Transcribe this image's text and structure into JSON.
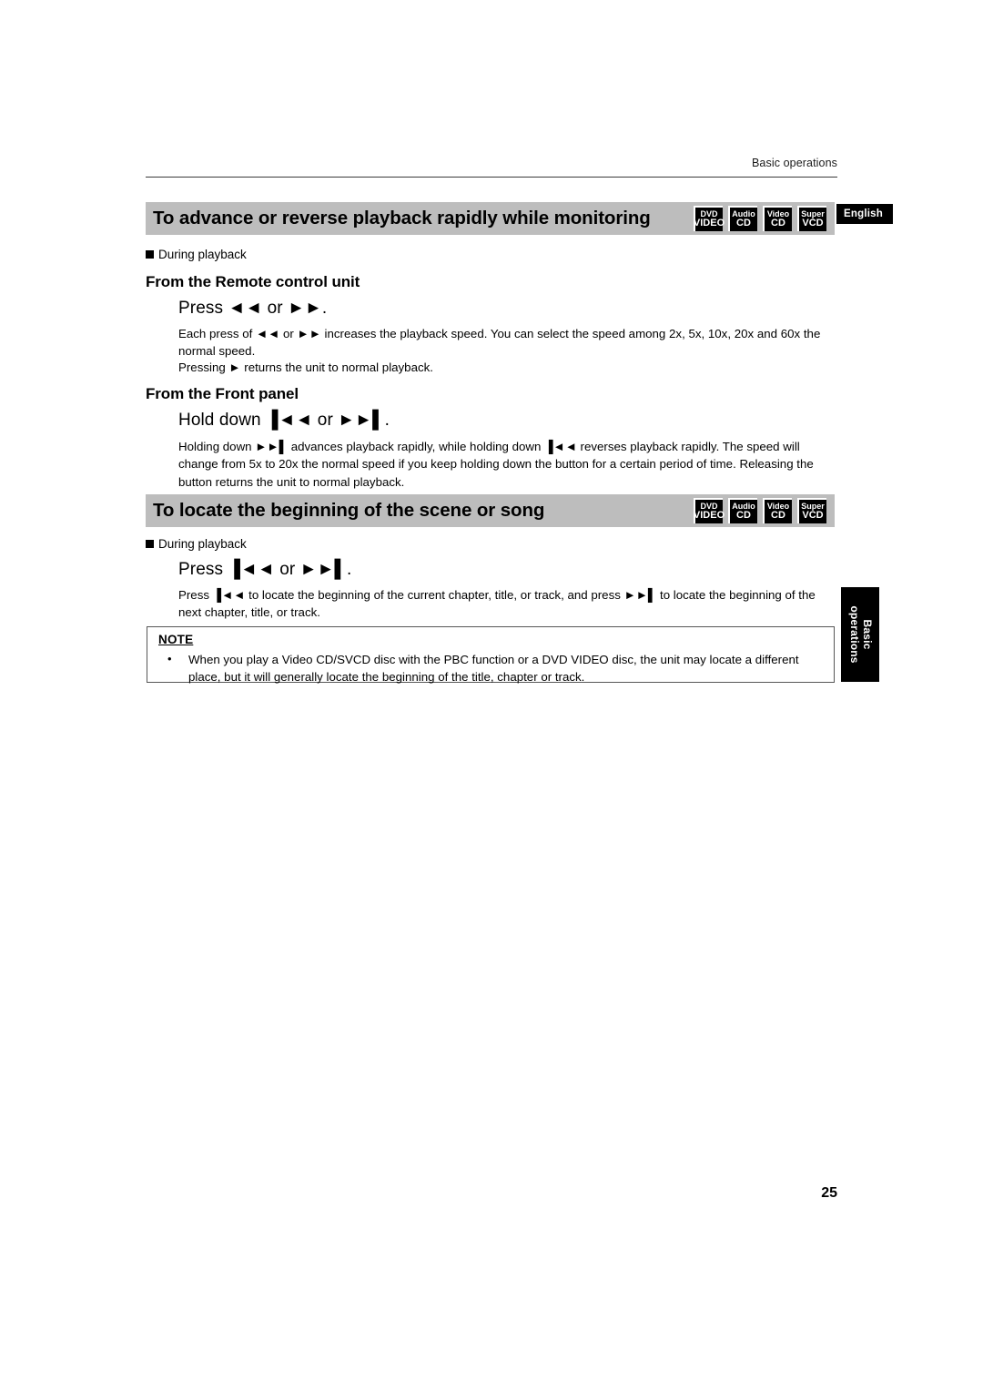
{
  "header": {
    "running_head": "Basic operations"
  },
  "language_tab": {
    "label": "English"
  },
  "side_tab": {
    "line1": "Basic",
    "line2": "operations"
  },
  "media_badges": [
    {
      "line1": "DVD",
      "line2": "VIDEO"
    },
    {
      "line1": "Audio",
      "line2": "CD"
    },
    {
      "line1": "Video",
      "line2": "CD"
    },
    {
      "line1": "Super",
      "line2": "VCD"
    }
  ],
  "sections": [
    {
      "title": "To advance or reverse playback rapidly while monitoring",
      "during_playback": "During playback",
      "subheads": [
        {
          "label": "From the Remote control unit",
          "step": "Press ◄◄ or ►►.",
          "paragraphs": [
            "Each press of ◄◄ or ►► increases the playback speed. You can select the speed among 2x, 5x, 10x, 20x and 60x the normal speed.",
            "Pressing ► returns the unit to normal playback."
          ]
        },
        {
          "label": "From the Front panel",
          "step": "Hold down ▐◄◄ or ►►▌.",
          "paragraphs": [
            "Holding down ►►▌ advances playback rapidly, while holding down ▐◄◄ reverses playback rapidly. The speed will change from 5x to 20x the normal speed if you keep holding down the button for a certain period of time.  Releasing the button returns the unit to normal playback."
          ]
        }
      ]
    },
    {
      "title": "To locate the beginning of the scene or song",
      "during_playback": "During playback",
      "subheads": [
        {
          "label": "",
          "step": "Press ▐◄◄ or ►►▌.",
          "paragraphs": [
            "Press ▐◄◄ to locate the beginning of the current chapter, title, or track, and press ►►▌ to locate the beginning of the next chapter, title, or track."
          ]
        }
      ]
    }
  ],
  "note": {
    "title": "NOTE",
    "bullet": "•",
    "text": "When you play a Video CD/SVCD disc with the PBC function or a DVD VIDEO disc, the unit may locate a different place, but it will generally locate the beginning of the title, chapter or track."
  },
  "folio": {
    "page_number": "25"
  }
}
